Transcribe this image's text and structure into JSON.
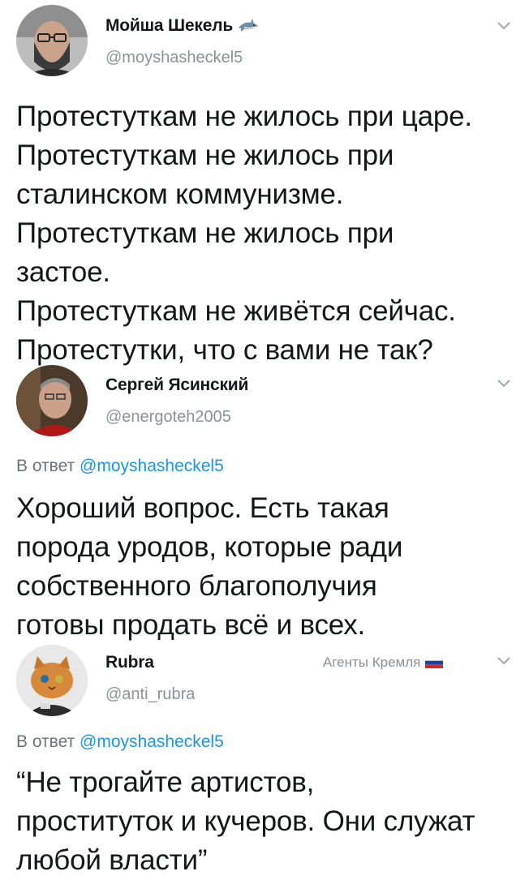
{
  "tweets": [
    {
      "name": "Мойша Шекель",
      "handle": "@moyshasheckel5",
      "text_lines": [
        "Протестуткам не жилось при царе.",
        "Протестуткам не жилось при",
        "сталинском коммунизме.",
        "Протестуткам не жилось при",
        "застое.",
        "Протестуткам не живётся сейчас.",
        "Протестутки, что с вами не так?"
      ]
    },
    {
      "name": "Сергей Ясинский",
      "handle": "@energoteh2005",
      "reply_prefix": "В ответ",
      "reply_mention": "@moyshasheckel5",
      "text_lines": [
        "Хороший вопрос. Есть такая",
        "порода уродов, которые ради",
        "собственного благополучия",
        "готовы продать всё и всех."
      ]
    },
    {
      "name": "Rubra",
      "handle": "@anti_rubra",
      "badge": "Агенты Кремля",
      "reply_prefix": "В ответ",
      "reply_mention": "@moyshasheckel5",
      "text_lines": [
        "“Не трогайте артистов,",
        "проституток и кучеров. Они служат",
        "любой власти”"
      ]
    }
  ]
}
